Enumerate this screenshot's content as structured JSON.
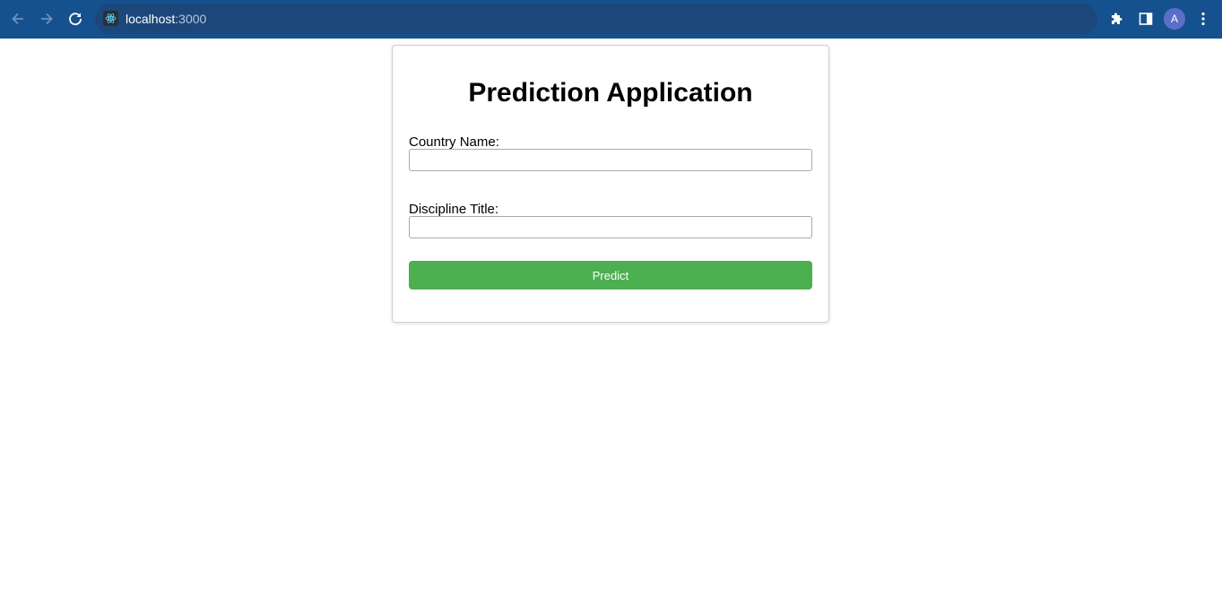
{
  "browser": {
    "url_host": "localhost",
    "url_port": ":3000",
    "avatar_initial": "A",
    "icons": {
      "back": "arrow-left-icon",
      "forward": "arrow-right-icon",
      "reload": "reload-icon",
      "site": "react-logo-icon",
      "extensions": "puzzle-icon",
      "side_panel": "side-panel-icon",
      "menu": "kebab-menu-icon"
    },
    "colors": {
      "toolbar": "#16518f",
      "omnibox": "#1c477a",
      "avatar": "#5b6fc8"
    }
  },
  "app": {
    "title": "Prediction Application",
    "country_label": "Country Name:",
    "country_value": "",
    "discipline_label": "Discipline Title:",
    "discipline_value": "",
    "predict_label": "Predict",
    "colors": {
      "button": "#4caf50"
    }
  }
}
